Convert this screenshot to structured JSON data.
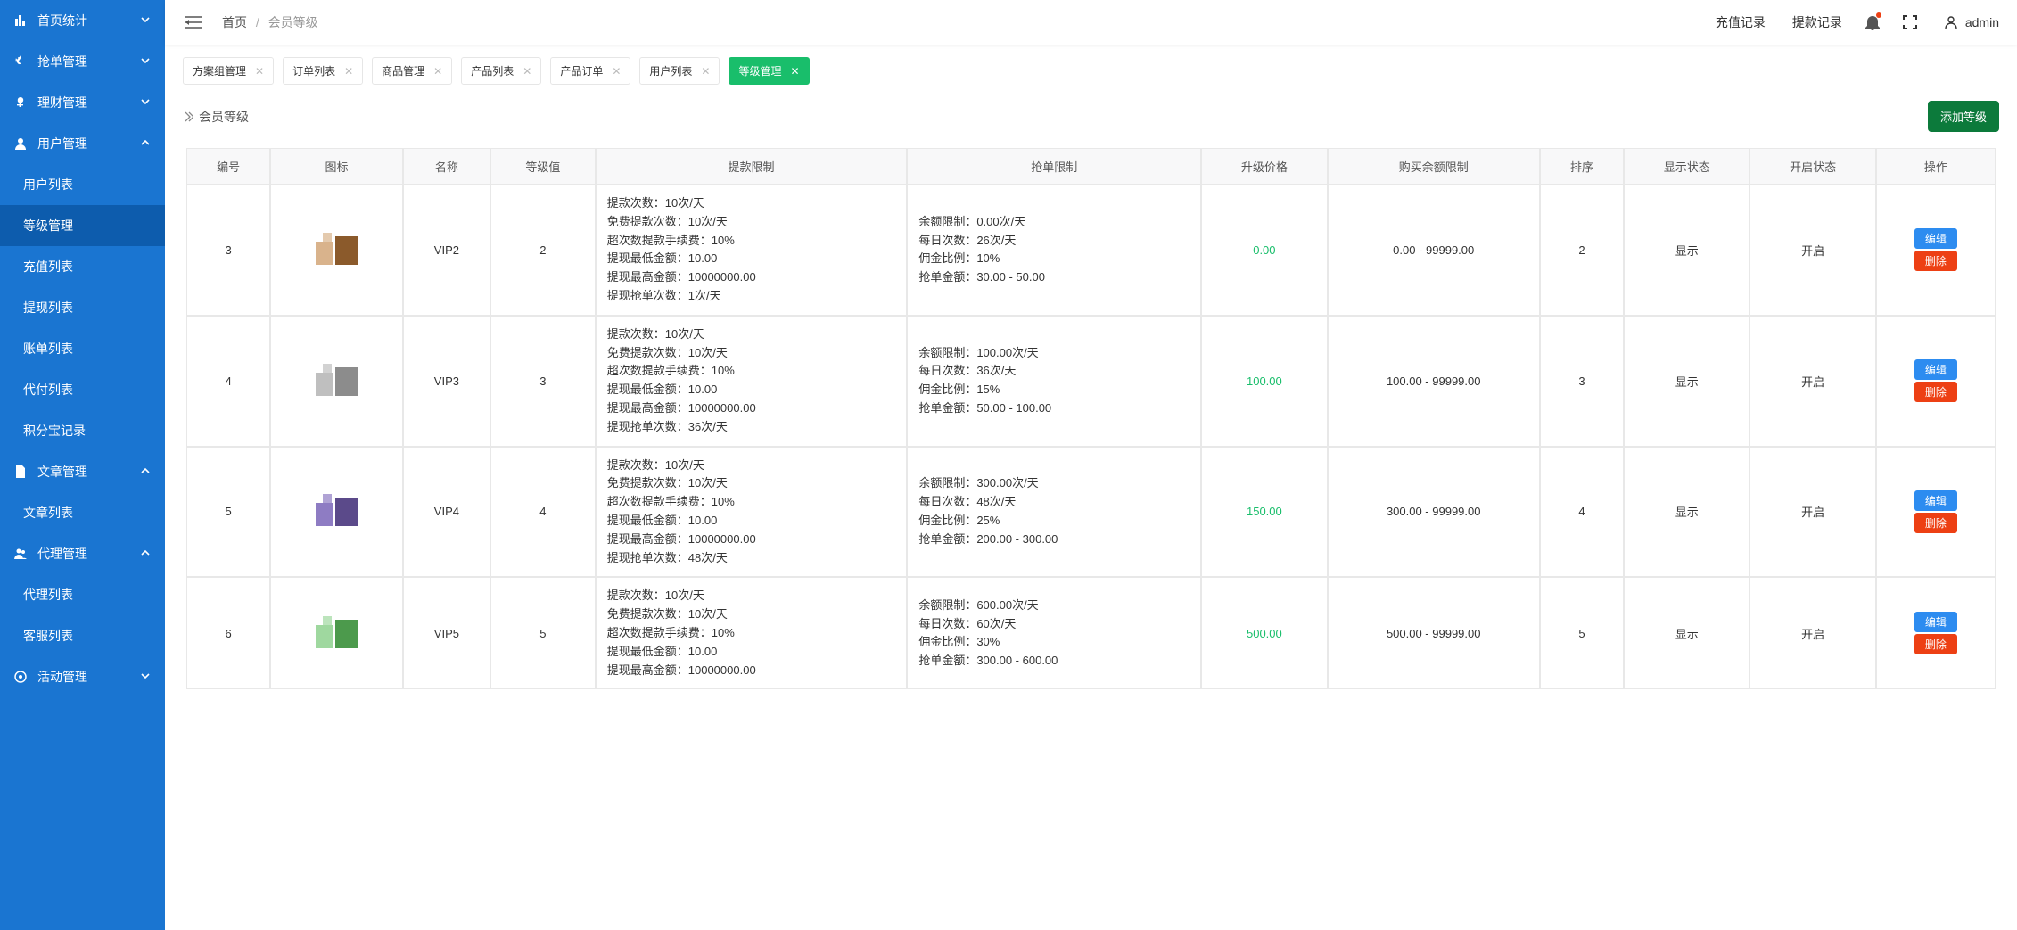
{
  "sidebar": [
    {
      "label": "首页统计",
      "icon": "chart",
      "open": false
    },
    {
      "label": "抢单管理",
      "icon": "fire",
      "open": false
    },
    {
      "label": "理财管理",
      "icon": "coin",
      "open": false
    },
    {
      "label": "用户管理",
      "icon": "user",
      "open": true,
      "children": [
        {
          "label": "用户列表",
          "active": false
        },
        {
          "label": "等级管理",
          "active": true
        },
        {
          "label": "充值列表",
          "active": false
        },
        {
          "label": "提现列表",
          "active": false
        },
        {
          "label": "账单列表",
          "active": false
        },
        {
          "label": "代付列表",
          "active": false
        },
        {
          "label": "积分宝记录",
          "active": false
        }
      ]
    },
    {
      "label": "文章管理",
      "icon": "doc",
      "open": true,
      "children": [
        {
          "label": "文章列表",
          "active": false
        }
      ]
    },
    {
      "label": "代理管理",
      "icon": "users",
      "open": true,
      "children": [
        {
          "label": "代理列表",
          "active": false
        },
        {
          "label": "客服列表",
          "active": false
        }
      ]
    },
    {
      "label": "活动管理",
      "icon": "gift",
      "open": false
    }
  ],
  "breadcrumb": {
    "home": "首页",
    "current": "会员等级"
  },
  "header": {
    "recharge": "充值记录",
    "withdraw": "提款记录",
    "user": "admin"
  },
  "tabs": [
    {
      "label": "方案组管理",
      "active": false,
      "closable": true
    },
    {
      "label": "订单列表",
      "active": false,
      "closable": true
    },
    {
      "label": "商品管理",
      "active": false,
      "closable": true
    },
    {
      "label": "产品列表",
      "active": false,
      "closable": true
    },
    {
      "label": "产品订单",
      "active": false,
      "closable": true
    },
    {
      "label": "用户列表",
      "active": false,
      "closable": true
    },
    {
      "label": "等级管理",
      "active": true,
      "closable": true
    }
  ],
  "page": {
    "title": "会员等级",
    "addBtn": "添加等级"
  },
  "table": {
    "headers": [
      "编号",
      "图标",
      "名称",
      "等级值",
      "提款限制",
      "抢单限制",
      "升级价格",
      "购买余额限制",
      "排序",
      "显示状态",
      "开启状态",
      "操作"
    ],
    "withdrawLabels": {
      "count": "提款次数：",
      "free": "免费提款次数：",
      "extraFee": "超次数提款手续费：",
      "min": "提现最低金额：",
      "max": "提现最高金额：",
      "grabCount": "提现抢单次数："
    },
    "grabLabels": {
      "balanceLimit": "余额限制：",
      "dailyCount": "每日次数：",
      "commission": "佣金比例：",
      "grabAmount": "抢单金额："
    },
    "opLabels": {
      "edit": "编辑",
      "del": "删除"
    },
    "rows": [
      {
        "id": "3",
        "name": "VIP2",
        "level": "2",
        "withdraw": {
          "count": "10次/天",
          "free": "10次/天",
          "extraFee": "10%",
          "min": "10.00",
          "max": "10000000.00",
          "grabCount": "1次/天"
        },
        "grab": {
          "balanceLimit": "0.00次/天",
          "dailyCount": "26次/天",
          "commission": "10%",
          "grabAmount": "30.00 - 50.00"
        },
        "price": "0.00",
        "balanceLimit": "0.00 - 99999.00",
        "sort": "2",
        "show": "显示",
        "enabled": "开启"
      },
      {
        "id": "4",
        "name": "VIP3",
        "level": "3",
        "withdraw": {
          "count": "10次/天",
          "free": "10次/天",
          "extraFee": "10%",
          "min": "10.00",
          "max": "10000000.00",
          "grabCount": "36次/天"
        },
        "grab": {
          "balanceLimit": "100.00次/天",
          "dailyCount": "36次/天",
          "commission": "15%",
          "grabAmount": "50.00 - 100.00"
        },
        "price": "100.00",
        "balanceLimit": "100.00 - 99999.00",
        "sort": "3",
        "show": "显示",
        "enabled": "开启"
      },
      {
        "id": "5",
        "name": "VIP4",
        "level": "4",
        "withdraw": {
          "count": "10次/天",
          "free": "10次/天",
          "extraFee": "10%",
          "min": "10.00",
          "max": "10000000.00",
          "grabCount": "48次/天"
        },
        "grab": {
          "balanceLimit": "300.00次/天",
          "dailyCount": "48次/天",
          "commission": "25%",
          "grabAmount": "200.00 - 300.00"
        },
        "price": "150.00",
        "balanceLimit": "300.00 - 99999.00",
        "sort": "4",
        "show": "显示",
        "enabled": "开启"
      },
      {
        "id": "6",
        "name": "VIP5",
        "level": "5",
        "withdraw": {
          "count": "10次/天",
          "free": "10次/天",
          "extraFee": "10%",
          "min": "10.00",
          "max": "10000000.00",
          "grabCount": ""
        },
        "grab": {
          "balanceLimit": "600.00次/天",
          "dailyCount": "60次/天",
          "commission": "30%",
          "grabAmount": "300.00 - 600.00"
        },
        "price": "500.00",
        "balanceLimit": "500.00 - 99999.00",
        "sort": "5",
        "show": "显示",
        "enabled": "开启"
      }
    ]
  }
}
